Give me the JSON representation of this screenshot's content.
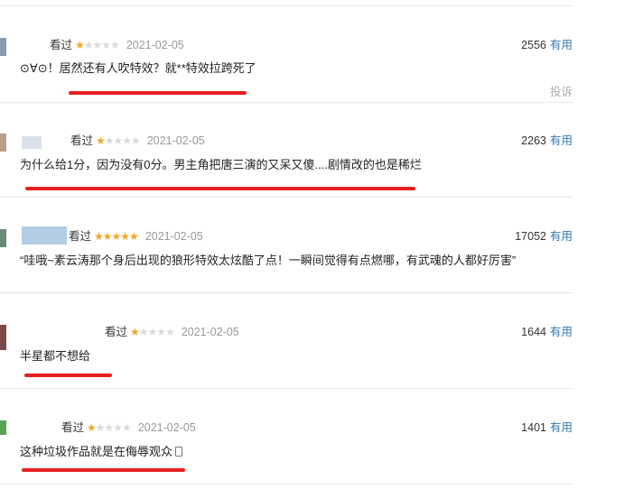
{
  "colors": {
    "accent": "#3377aa",
    "star": "#f5a623",
    "annotation": "#e62020"
  },
  "reviews": [
    {
      "status": "看过",
      "rating": 1,
      "rating_display": "★★★★★",
      "date": "2021-02-05",
      "votes": "2556",
      "useful_label": "有用",
      "content": "⊙∀⊙！居然还有人吹特效？就**特效拉跨死了",
      "report_label": "投诉"
    },
    {
      "status": "看过",
      "rating": 1,
      "rating_display": "★★★★★",
      "date": "2021-02-05",
      "votes": "2263",
      "useful_label": "有用",
      "content": "为什么给1分，因为没有0分。男主角把唐三演的又呆又傻....剧情改的也是稀烂"
    },
    {
      "status": "看过",
      "rating": 5,
      "rating_display": "★★★★★",
      "date": "2021-02-05",
      "votes": "17052",
      "useful_label": "有用",
      "content": "“哇哦~素云涛那个身后出现的狼形特效太炫酷了点！一瞬间觉得有点燃哪，有武魂的人都好厉害”"
    },
    {
      "status": "看过",
      "rating": 1,
      "rating_display": "★★★★★",
      "date": "2021-02-05",
      "votes": "1644",
      "useful_label": "有用",
      "content": "半星都不想给"
    },
    {
      "status": "看过",
      "rating": 1,
      "rating_display": "★★★★★",
      "date": "2021-02-05",
      "votes": "1401",
      "useful_label": "有用",
      "content": "这种垃圾作品就是在侮辱观众",
      "icon": "phone-icon"
    }
  ]
}
